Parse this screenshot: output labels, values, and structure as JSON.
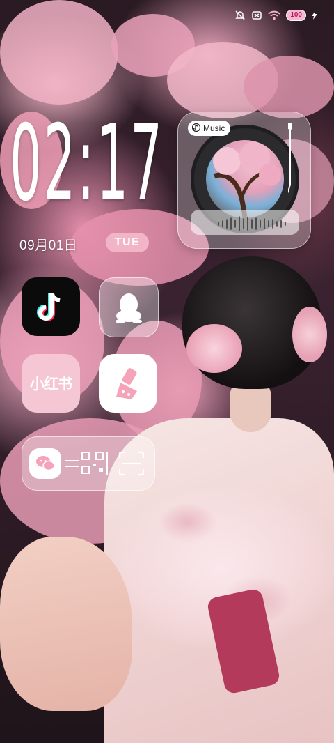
{
  "status_bar": {
    "icons": [
      "mute-bell-icon",
      "no-sim-icon",
      "wifi-icon",
      "battery-icon",
      "charging-bolt-icon"
    ],
    "battery_level": "100"
  },
  "clock": {
    "time": "02:17",
    "date": "09月01日",
    "weekday": "TUE"
  },
  "music_widget": {
    "label": "Music",
    "icon": "music-note-icon"
  },
  "apps": [
    {
      "name": "TikTok",
      "icon": "tiktok-icon"
    },
    {
      "name": "QQ",
      "icon": "qq-penguin-icon"
    },
    {
      "name": "小红书",
      "icon_text": "小红书"
    },
    {
      "name": "Cleaner",
      "icon": "cleaner-brush-icon"
    }
  ],
  "shortcut_bar": {
    "icons": [
      "wechat-icon",
      "qr-pay-icon",
      "scan-icon"
    ]
  },
  "colors": {
    "accent_pink": "#f2b4c7",
    "widget_glass": "rgba(255,255,255,0.3)"
  }
}
